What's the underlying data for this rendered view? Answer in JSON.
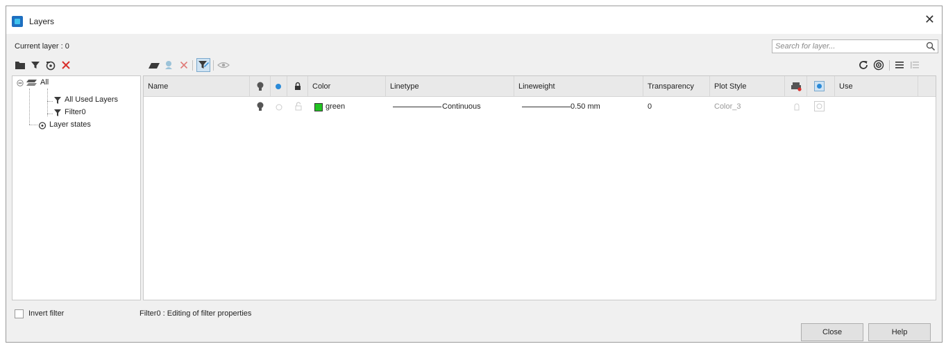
{
  "window": {
    "title": "Layers"
  },
  "current_layer": "Current layer : 0",
  "search": {
    "placeholder": "Search for layer..."
  },
  "tree": {
    "root": "All",
    "filters": [
      "All Used Layers",
      "Filter0"
    ],
    "states": "Layer states"
  },
  "columns": {
    "name": "Name",
    "color": "Color",
    "linetype": "Linetype",
    "lineweight": "Lineweight",
    "transparency": "Transparency",
    "plot_style": "Plot Style",
    "use": "Use"
  },
  "rows": [
    {
      "name": "",
      "color_name": "green",
      "color_hex": "#22c322",
      "linetype": "Continuous",
      "lineweight": "0.50 mm",
      "transparency": "0",
      "plot_style": "Color_3"
    }
  ],
  "footer": {
    "invert_filter": "Invert filter",
    "status": "Filter0 : Editing of filter properties",
    "close_label": "Close",
    "help_label": "Help"
  },
  "colors": {
    "accent_blue": "#1e6fc0",
    "delete_red": "#d9302c",
    "active_blue": "#2a8ad8"
  }
}
